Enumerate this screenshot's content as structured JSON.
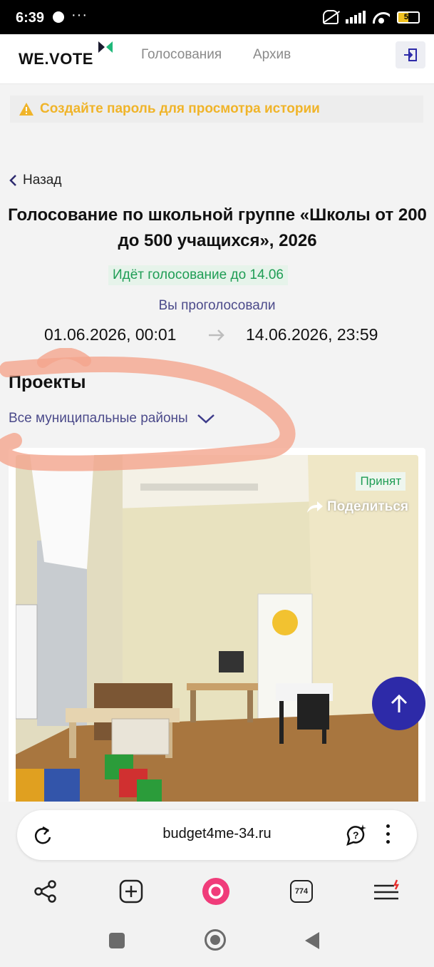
{
  "status_bar": {
    "time": "6:39",
    "more": "···",
    "battery": "50"
  },
  "header": {
    "logo": "WE.VOTE",
    "nav": [
      "Голосования",
      "Архив"
    ]
  },
  "warning": {
    "text": "Создайте пароль для просмотра истории"
  },
  "back_label": "Назад",
  "vote": {
    "title": "Голосование по школьной группе «Школы от 200 до 500 учащихся», 2026",
    "status": "Идёт голосование до 14.06",
    "voted_text": "Вы проголосовали",
    "start": "01.06.2026, 00:01",
    "end": "14.06.2026, 23:59"
  },
  "projects": {
    "heading": "Проекты",
    "filter": "Все муниципальные районы"
  },
  "card": {
    "badge": "Принят",
    "share": "Поделиться"
  },
  "browser": {
    "url": "budget4me-34.ru",
    "tabs_count": "774"
  },
  "colors": {
    "accent": "#2d2aa8",
    "status_green": "#1f9d55",
    "warning": "#f0b429",
    "link_purple": "#4b4a8a"
  }
}
